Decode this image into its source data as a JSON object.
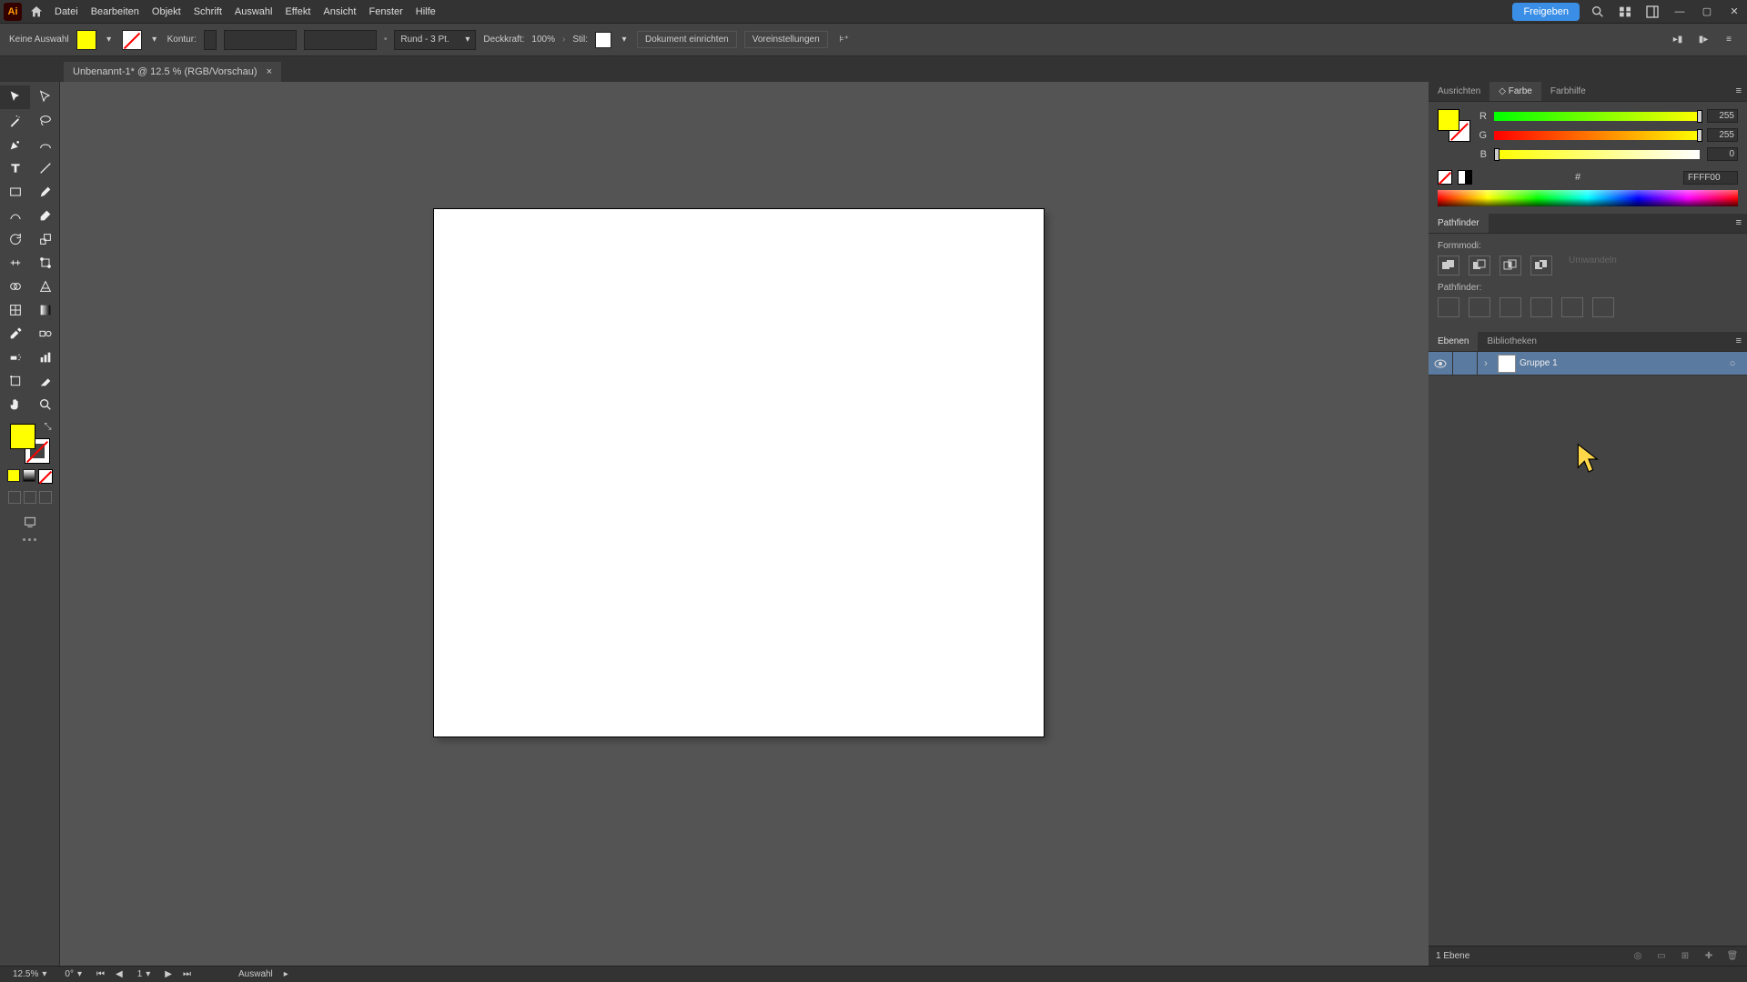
{
  "menubar": {
    "app": "Ai",
    "items": [
      "Datei",
      "Bearbeiten",
      "Objekt",
      "Schrift",
      "Auswahl",
      "Effekt",
      "Ansicht",
      "Fenster",
      "Hilfe"
    ],
    "share": "Freigeben"
  },
  "controlbar": {
    "selection": "Keine Auswahl",
    "kontur_label": "Kontur:",
    "stroke_profile": "Rund - 3 Pt.",
    "opacity_label": "Deckkraft:",
    "opacity_value": "100%",
    "style_label": "Stil:",
    "doc_setup": "Dokument einrichten",
    "prefs": "Voreinstellungen"
  },
  "document": {
    "tab_title": "Unbenannt-1* @ 12.5 % (RGB/Vorschau)",
    "close": "×"
  },
  "color_panel": {
    "tabs": [
      "Ausrichten",
      "Farbe",
      "Farbhilfe"
    ],
    "active_tab_prefix": "◇",
    "channels": [
      {
        "label": "R",
        "value": "255",
        "percent": 100
      },
      {
        "label": "G",
        "value": "255",
        "percent": 100
      },
      {
        "label": "B",
        "value": "0",
        "percent": 0
      }
    ],
    "hex_prefix": "#",
    "hex": "FFFF00"
  },
  "pathfinder": {
    "tab": "Pathfinder",
    "shape_modes": "Formmodi:",
    "expand": "Umwandeln",
    "pathfinder_label": "Pathfinder:"
  },
  "layers": {
    "tabs": [
      "Ebenen",
      "Bibliotheken"
    ],
    "rows": [
      {
        "name": "Gruppe 1"
      }
    ],
    "footer_count": "1 Ebene"
  },
  "status": {
    "zoom": "12.5%",
    "rotation": "0°",
    "artboard": "1",
    "tool": "Auswahl"
  },
  "colors": {
    "accent": "#3a8ee6",
    "fill": "#ffff00"
  }
}
